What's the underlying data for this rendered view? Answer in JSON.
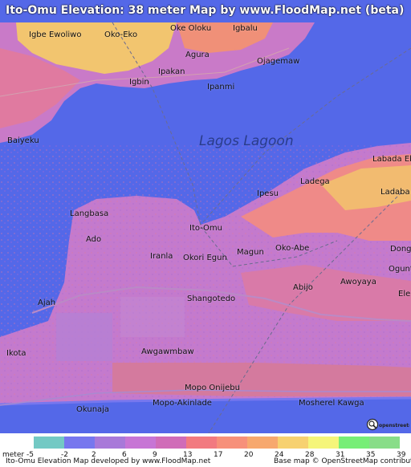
{
  "title": "Ito-Omu Elevation: 38 meter Map by www.FloodMap.net (beta)",
  "water_label": "Lagos Lagoon",
  "places": [
    {
      "id": "igbe-ewoliwo",
      "name": "Igbe Ewoliwo"
    },
    {
      "id": "oko-eko",
      "name": "Oko-Eko"
    },
    {
      "id": "oke-oloku",
      "name": "Oke Oloku"
    },
    {
      "id": "igbalu",
      "name": "Igbalu"
    },
    {
      "id": "agura",
      "name": "Agura"
    },
    {
      "id": "ojagemaw",
      "name": "Ojagemaw"
    },
    {
      "id": "igbin",
      "name": "Igbin"
    },
    {
      "id": "ipakan",
      "name": "Ipakan"
    },
    {
      "id": "ipanmi",
      "name": "Ipanmi"
    },
    {
      "id": "baiyeku",
      "name": "Baiyeku"
    },
    {
      "id": "labada-eb",
      "name": "Labada Eb"
    },
    {
      "id": "ladega",
      "name": "Ladega"
    },
    {
      "id": "ipesu",
      "name": "Ipesu"
    },
    {
      "id": "ladaba",
      "name": "Ladaba"
    },
    {
      "id": "langbasa",
      "name": "Langbasa"
    },
    {
      "id": "ado",
      "name": "Ado"
    },
    {
      "id": "ito-omu",
      "name": "Ito-Omu"
    },
    {
      "id": "iranla",
      "name": "Iranla"
    },
    {
      "id": "okori-egun",
      "name": "Okori Egun"
    },
    {
      "id": "magun",
      "name": "Magun"
    },
    {
      "id": "oko-abe",
      "name": "Oko-Abe"
    },
    {
      "id": "dong",
      "name": "Dong"
    },
    {
      "id": "ogunt",
      "name": "Ogunt"
    },
    {
      "id": "awoyaya",
      "name": "Awoyaya"
    },
    {
      "id": "abijo",
      "name": "Abijo"
    },
    {
      "id": "ele",
      "name": "Ele"
    },
    {
      "id": "ajah",
      "name": "Ajah"
    },
    {
      "id": "shangotedo",
      "name": "Shangotedo"
    },
    {
      "id": "ikota",
      "name": "Ikota"
    },
    {
      "id": "awgawmbaw",
      "name": "Awgawmbaw"
    },
    {
      "id": "mopo-onijebu",
      "name": "Mopo Onijebu"
    },
    {
      "id": "mopo-akinlade",
      "name": "Mopo-Akinlade"
    },
    {
      "id": "mosherel-kawga",
      "name": "Mosherel Kawga"
    },
    {
      "id": "okunaja",
      "name": "Okunaja"
    }
  ],
  "legend": {
    "unit": "meter",
    "ticks": [
      "-5",
      "-2",
      "2",
      "6",
      "9",
      "13",
      "17",
      "20",
      "24",
      "28",
      "31",
      "35",
      "39"
    ],
    "colors": [
      "#73c9c4",
      "#7777ee",
      "#a879d9",
      "#c775d5",
      "#d06cb8",
      "#f27a80",
      "#f7907a",
      "#f7a86e",
      "#f7d170",
      "#f5f57a",
      "#77ee77",
      "#88dd88"
    ]
  },
  "colors": {
    "water": "#5468e8",
    "lowland": "#c47acd",
    "midland": "#e07aa0",
    "highland": "#f2d27a"
  },
  "footer": {
    "left": "Ito-Omu Elevation Map developed by www.FloodMap.net",
    "right": "Base map © OpenStreetMap contributors"
  },
  "osm_logo_text": "openstreetmap"
}
